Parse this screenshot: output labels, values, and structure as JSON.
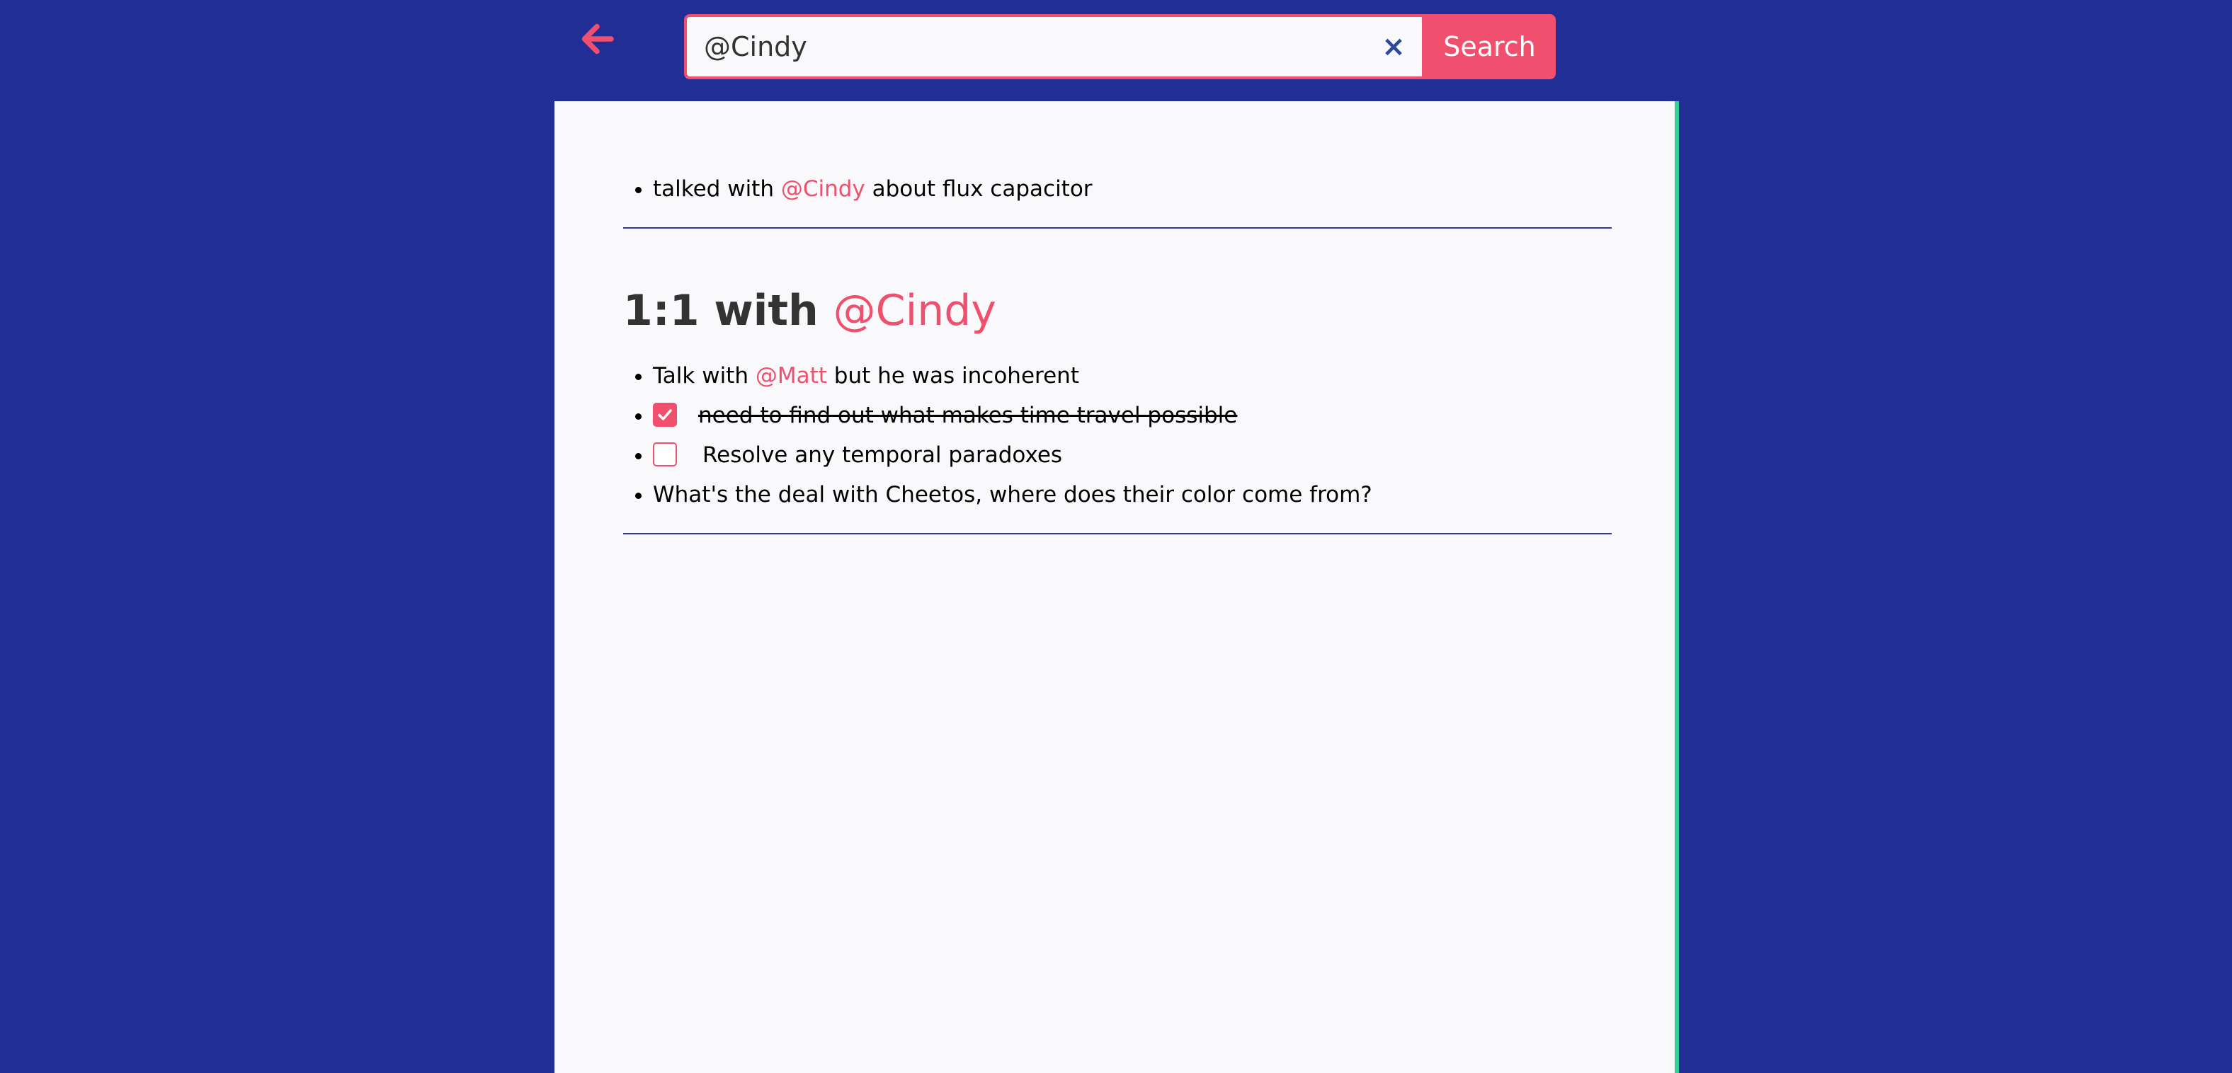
{
  "colors": {
    "background": "#212e96",
    "accent": "#f0506e",
    "panel": "#f9f9fb",
    "panel_border": "#32d296",
    "divider": "#2b3a9c"
  },
  "toolbar": {
    "back_icon": "arrow-left-icon",
    "search": {
      "value": "@Cindy",
      "placeholder": "",
      "clear_label": "×",
      "button_label": "Search"
    }
  },
  "results": [
    {
      "items": [
        {
          "parts": [
            "talked with ",
            "@Cindy",
            " about flux capacitor"
          ]
        }
      ]
    },
    {
      "heading": {
        "text": "1:1 with ",
        "mention": "@Cindy"
      },
      "items": [
        {
          "parts": [
            "Talk with ",
            "@Matt",
            " but he was incoherent"
          ]
        },
        {
          "checked": true,
          "text": "need to find out what makes time travel possible"
        },
        {
          "checked": false,
          "text": "Resolve any temporal paradoxes"
        },
        {
          "text": "What's the deal with Cheetos, where does their color come from?"
        }
      ]
    }
  ]
}
